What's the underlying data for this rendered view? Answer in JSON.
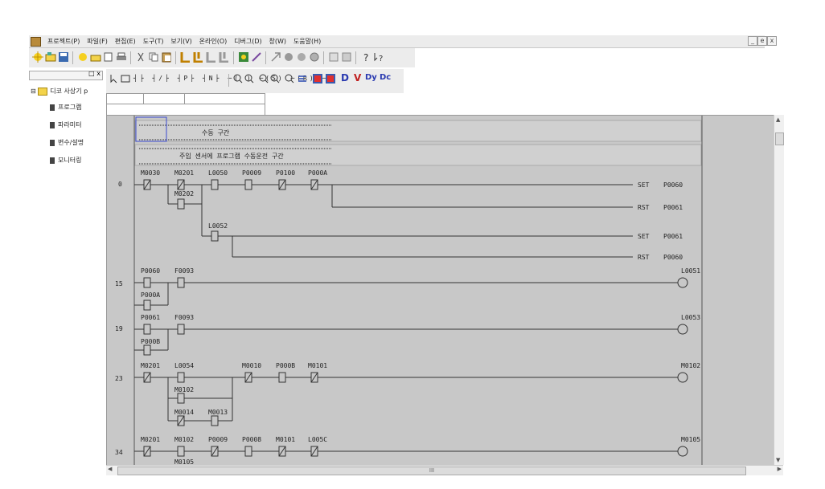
{
  "menu": {
    "items": [
      "프로젝트(P)",
      "파일(F)",
      "편집(E)",
      "도구(T)",
      "보기(V)",
      "온라인(O)",
      "디버그(D)",
      "창(W)",
      "도움말(H)"
    ],
    "window_controls": [
      "_",
      "e",
      "x"
    ]
  },
  "toolbar_icons": [
    "new-project-icon",
    "open-icon",
    "save-icon",
    "new-icon",
    "open-file-icon",
    "print-preview-icon",
    "print-icon",
    "cut-icon",
    "copy-icon",
    "paste-icon",
    "ladder-icon",
    "ladder-edit-icon",
    "compile-icon",
    "compile-all-icon",
    "monitor-icon",
    "link-icon",
    "connect-icon",
    "stop-icon",
    "run-icon",
    "record-icon",
    "list-icon",
    "list2-icon",
    "help-icon",
    "context-help-icon"
  ],
  "ladder_toolbar": {
    "mode_icons": [
      "pointer-icon",
      "rectangle-icon"
    ],
    "contact_glyphs": [
      "F3",
      "F4",
      "F5",
      "F6",
      "F7",
      "F8",
      "F9",
      "F10"
    ],
    "zoom_icons": [
      "zoom-in-icon",
      "zoom-out-icon",
      "zoom-in-2-icon",
      "zoom-out-2-icon",
      "zoom-fit-icon",
      "align-icon"
    ],
    "letter_buttons": [
      "D",
      "V",
      "Dy",
      "Dc"
    ]
  },
  "tree": {
    "root": "디코 사상기 p",
    "items": [
      "프로그램",
      "파라미터",
      "변수/설명",
      "모니터링"
    ]
  },
  "ladder": {
    "comment1": "수동 구간",
    "comment2": "주입 센서에 프로그램 수동운전 구간",
    "step_numbers": [
      "0",
      "15",
      "19",
      "23",
      "34"
    ],
    "contacts": {
      "r0": [
        "M0030",
        "M0201",
        "L0050",
        "P0009",
        "P0100",
        "P000A"
      ],
      "r0b": [
        "M0202"
      ],
      "r0c": [
        "L0052"
      ],
      "r15": [
        "P0060",
        "F0093"
      ],
      "r15b": [
        "P000A"
      ],
      "r19": [
        "P0061",
        "F0093"
      ],
      "r19b": [
        "P000B"
      ],
      "r23": [
        "M0201",
        "L0054",
        "M0010",
        "P000B",
        "M0101"
      ],
      "r23b": [
        "M0102"
      ],
      "r23c": [
        "M0014",
        "M0013"
      ],
      "r34": [
        "M0201",
        "M0102",
        "P0009",
        "P0008",
        "M0101",
        "L005C"
      ],
      "r34b": [
        "M0105"
      ]
    },
    "instructions": [
      {
        "op": "SET",
        "arg": "P0060"
      },
      {
        "op": "RST",
        "arg": "P0061"
      },
      {
        "op": "SET",
        "arg": "P0061"
      },
      {
        "op": "RST",
        "arg": "P0060"
      }
    ],
    "coils": [
      "L0051",
      "L0053",
      "M0102",
      "M0105"
    ]
  },
  "hscroll_thumb_label": "III"
}
